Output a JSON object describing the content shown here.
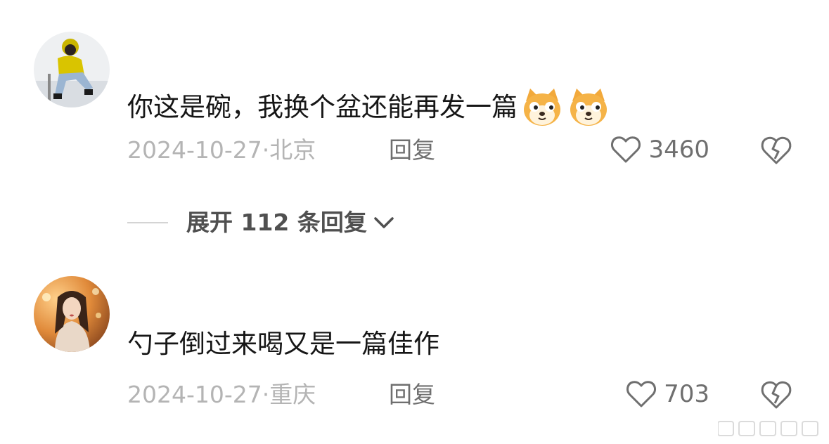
{
  "comments": [
    {
      "text": "你这是碗，我换个盆还能再发一篇",
      "emojis": [
        "shiba-dog-emoji",
        "shiba-dog-emoji"
      ],
      "date": "2024-10-27",
      "location": "北京",
      "reply_label": "回复",
      "likes": "3460"
    },
    {
      "text": "勺子倒过来喝又是一篇佳作",
      "emojis": [],
      "date": "2024-10-27",
      "location": "重庆",
      "reply_label": "回复",
      "likes": "703"
    }
  ],
  "expand": {
    "label": "展开 112 条回复"
  },
  "icons": {
    "like": "heart-outline-icon",
    "dislike": "broken-heart-icon",
    "expand": "chevron-down-icon"
  },
  "colors": {
    "text": "#161616",
    "meta": "#b4b4b4",
    "action": "#6f6f6f",
    "expand": "#505050"
  }
}
